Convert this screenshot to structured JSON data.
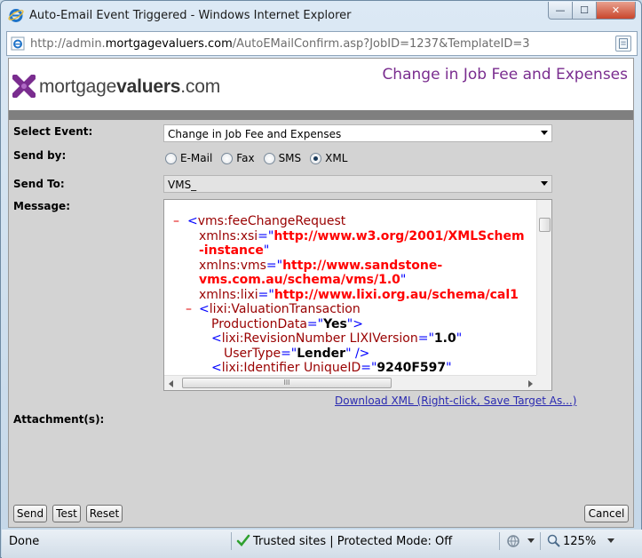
{
  "window": {
    "title": "Auto-Email Event Triggered - Windows Internet Explorer",
    "minimize_icon": "minimize-icon",
    "maximize_icon": "maximize-icon",
    "close_icon": "close-icon",
    "minimize_glyph": "—",
    "maximize_glyph": "☐",
    "close_glyph": "✕"
  },
  "address": {
    "url_prefix": "http://admin.",
    "url_domain": "mortgagevaluers.com",
    "url_suffix": "/AutoEMailConfirm.asp?JobID=1237&TemplateID=3"
  },
  "header": {
    "logo_text_light": "mortgage",
    "logo_text_bold": "valuers",
    "logo_text_tld": ".com",
    "page_title": "Change in Job Fee and Expenses"
  },
  "form": {
    "select_event_label": "Select Event:",
    "select_event_value": "Change in Job Fee and Expenses",
    "send_by_label": "Send by:",
    "send_by_options": [
      "E-Mail",
      "Fax",
      "SMS",
      "XML"
    ],
    "send_by_selected": "XML",
    "send_to_label": "Send To:",
    "send_to_value": "VMS_",
    "message_label": "Message:",
    "attachments_label": "Attachment(s):",
    "download_link": "Download XML (Right-click, Save Target As...)"
  },
  "xml": {
    "l1_tag": "vms:feeChangeRequest",
    "l2_attr": "xmlns:xsi",
    "l2_val": "http://www.w3.org/2001/XMLSchem",
    "l3_val": "-instance",
    "l4_attr": "xmlns:vms",
    "l4_val": "http://www.sandstone-",
    "l5_val": "vms.com.au/schema/vms/1.0",
    "l6_attr": "xmlns:lixi",
    "l6_val": "http://www.lixi.org.au/schema/cal1",
    "l7_tag": "lixi:ValuationTransaction",
    "l8_attr": "ProductionData",
    "l8_val": "Yes",
    "l9_tag": "lixi:RevisionNumber",
    "l9_attr": "LIXIVersion",
    "l9_val": "1.0",
    "l10_attr": "UserType",
    "l10_val": "Lender",
    "l11_tag": "lixi:Identifier",
    "l11_attr": "UniqueID",
    "l11_val": "9240F597",
    "minus": "–",
    "hthumb_grip": "III"
  },
  "buttons": {
    "send": "Send",
    "test": "Test",
    "reset": "Reset",
    "cancel": "Cancel"
  },
  "status": {
    "done": "Done",
    "zone": "Trusted sites | Protected Mode: Off",
    "zoom": "125%"
  },
  "colors": {
    "brand_purple": "#7a2d8f",
    "xml_tag": "#990000",
    "xml_value": "#ff0000",
    "xml_bracket": "#0000ff"
  }
}
